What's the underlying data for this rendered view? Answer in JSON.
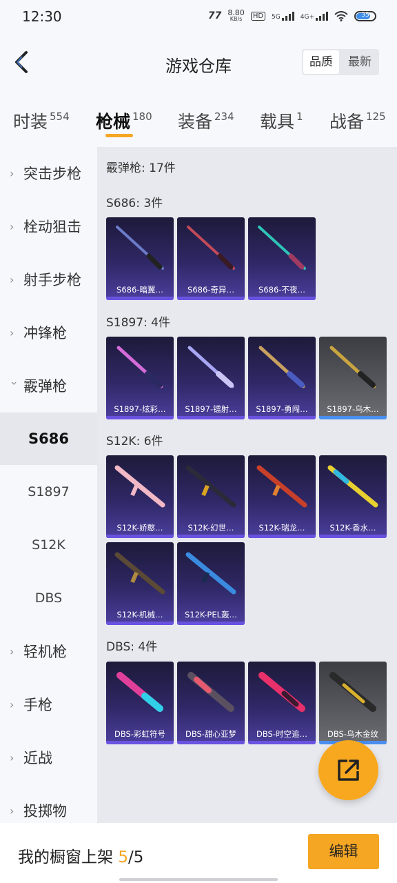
{
  "status": {
    "time": "12:30",
    "speed_value": "8.80",
    "speed_unit": "KB/s",
    "hd": "HD",
    "net1": "5G",
    "net2": "4G+",
    "battery": "35"
  },
  "header": {
    "title": "游戏仓库",
    "sort_options": [
      "品质",
      "最新"
    ],
    "sort_active": "品质"
  },
  "tabs": [
    {
      "label": "时装",
      "count": "554"
    },
    {
      "label": "枪械",
      "count": "180",
      "active": true
    },
    {
      "label": "装备",
      "count": "234"
    },
    {
      "label": "载具",
      "count": "1"
    },
    {
      "label": "战备",
      "count": "125"
    }
  ],
  "sidebar": {
    "items": [
      {
        "label": "突击步枪"
      },
      {
        "label": "栓动狙击"
      },
      {
        "label": "射手步枪"
      },
      {
        "label": "冲锋枪"
      },
      {
        "label": "霰弹枪",
        "expanded": true
      },
      {
        "label": "S686",
        "sub": true,
        "selected": true
      },
      {
        "label": "S1897",
        "sub": true
      },
      {
        "label": "S12K",
        "sub": true
      },
      {
        "label": "DBS",
        "sub": true
      },
      {
        "label": "轻机枪"
      },
      {
        "label": "手枪"
      },
      {
        "label": "近战"
      },
      {
        "label": "投掷物"
      }
    ]
  },
  "main": {
    "category_summary": "霰弹枪: 17件",
    "sections": [
      {
        "title": "S686: 3件",
        "items": [
          {
            "label": "S686-暗翼…",
            "quality": "purple"
          },
          {
            "label": "S686-奇异…",
            "quality": "purple"
          },
          {
            "label": "S686-不夜…",
            "quality": "purple"
          }
        ]
      },
      {
        "title": "S1897: 4件",
        "items": [
          {
            "label": "S1897-炫彩…",
            "quality": "purple"
          },
          {
            "label": "S1897-镭射…",
            "quality": "purple"
          },
          {
            "label": "S1897-勇闯…",
            "quality": "purple"
          },
          {
            "label": "S1897-乌木…",
            "quality": "gray"
          }
        ]
      },
      {
        "title": "S12K: 6件",
        "items": [
          {
            "label": "S12K-娇憨…",
            "quality": "purple"
          },
          {
            "label": "S12K-幻世…",
            "quality": "purple"
          },
          {
            "label": "S12K-瑞龙…",
            "quality": "purple"
          },
          {
            "label": "S12K-香水…",
            "quality": "purple"
          },
          {
            "label": "S12K-机械…",
            "quality": "purple"
          },
          {
            "label": "S12K-PEL轰…",
            "quality": "purple"
          }
        ]
      },
      {
        "title": "DBS: 4件",
        "items": [
          {
            "label": "DBS-彩虹符号",
            "quality": "purple"
          },
          {
            "label": "DBS-甜心亚梦",
            "quality": "purple"
          },
          {
            "label": "DBS-时空追…",
            "quality": "purple"
          },
          {
            "label": "DBS-乌木金纹",
            "quality": "gray"
          }
        ]
      }
    ]
  },
  "bottom": {
    "prefix": "我的橱窗上架 ",
    "current": "5",
    "separator": "/",
    "total": "5",
    "edit_label": "编辑"
  },
  "colors": {
    "accent": "#f5a623",
    "purple_card": "#2f2866",
    "gray_card": "#55575d"
  },
  "icons": {
    "back": "back-arrow-icon",
    "share": "share-export-icon"
  }
}
